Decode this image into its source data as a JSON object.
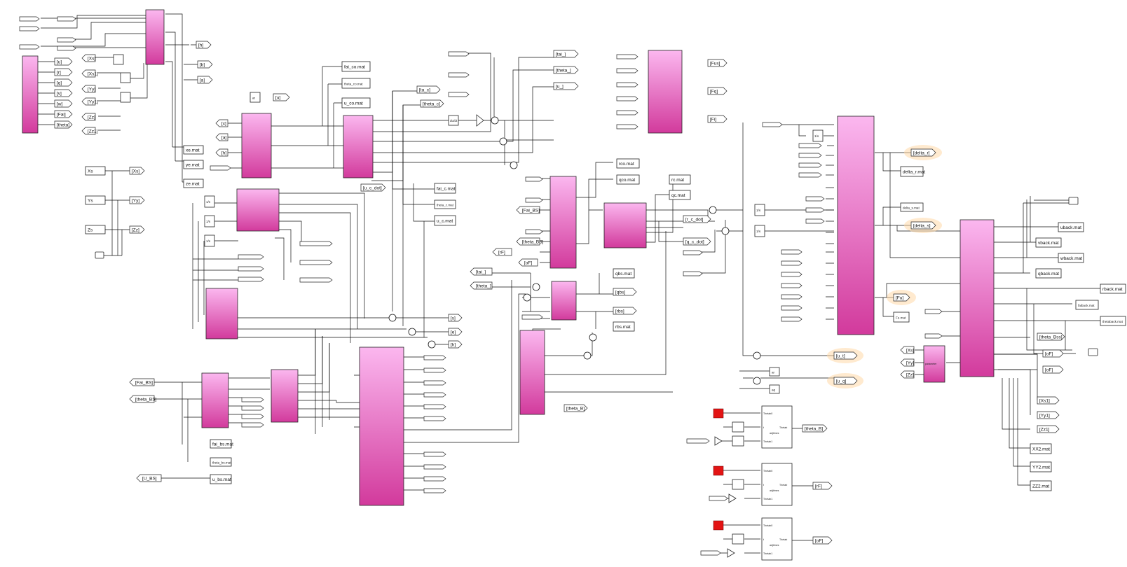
{
  "from_tags": {
    "left1": [
      "[u]",
      "[r]",
      "[q]",
      "[v]",
      "[w]",
      "[Fai]",
      "[theta]"
    ],
    "xyz": [
      "[Xs]",
      "[Xs1]",
      "[Yy]",
      "[Yy1]",
      "[Zz]",
      "[Zz1]"
    ],
    "uv": [
      "[x]",
      "[a]",
      "[h]"
    ],
    "mid": [
      "[tai_]",
      "[theta_]",
      "[Fai_BS]",
      "[theta_BS]",
      "[rF]",
      "[oF]"
    ],
    "left_bottom": [
      "[Fai_BS]",
      "[theta_BS]",
      "[U_BS]"
    ],
    "right": [
      "[Xs]",
      "[Yy]",
      "[Zz]"
    ]
  },
  "goto_tags": {
    "top_left": [
      "[h]",
      "[b]",
      "[a]"
    ],
    "center_top": [
      "[tai_]",
      "[theta_]",
      "[u_]"
    ],
    "center": [
      "[ta_c]",
      "[theta_c]",
      "[u_c_dot]"
    ],
    "xyz": [
      "[Xs]",
      "[Yy]",
      "[Zz]"
    ],
    "sum_outs": [
      "[s]",
      "[e]",
      "[h]"
    ],
    "fx": [
      "[Fus]",
      "[Fq]",
      "[Fi]"
    ],
    "mid": [
      "[r_c_dot]",
      "[q_c_dot]",
      "[qbs]",
      "[rbs]",
      "[theta_B]"
    ],
    "right_glow": [
      "[delta_r]",
      "[delta_s]",
      "[Fu]",
      "[u_t]",
      "[u_q]"
    ],
    "right2": [
      "[theta_Bss]",
      "[oF]",
      "[oF]"
    ],
    "right3": [
      "[Xs1]",
      "[Yy1]",
      "[Zz1]"
    ],
    "bottom": [
      "[theta_B]",
      "[rF]",
      "[oF]"
    ],
    "misc": [
      "[u]"
    ]
  },
  "consts": [
    "Xs",
    "Ys",
    "Zs"
  ],
  "mat_files": {
    "xyz": [
      "xe.mat",
      "ye.mat",
      "ze.mat"
    ],
    "center": [
      "fai_co.mat",
      "theta_co.mat",
      "u_co.mat"
    ],
    "cmat": [
      "fai_c.mat",
      "theta_c.mat",
      "u_c.mat"
    ],
    "rq": [
      "rco.mat",
      "qco.mat",
      "rc.mat",
      "qc.mat"
    ],
    "bs": [
      "qbs.mat",
      "rbs.mat"
    ],
    "delta": [
      "delta_r.mat",
      "delta_s.mat",
      "Fu.mat"
    ],
    "back": [
      "uback.mat",
      "vback.mat",
      "wback.mat",
      "qback.mat",
      "rback.mat",
      "faiback.mat",
      "thetaback.mat"
    ],
    "bs_left": [
      "fai_bs.mat",
      "theta_bs.mat",
      "u_bs.mat"
    ],
    "xx": [
      "XX2.mat",
      "YY2.mat",
      "ZZ2.mat"
    ]
  },
  "small_boxes": [
    "ar",
    "aq"
  ],
  "port_text": {
    "derivative": "du/dt",
    "gain": "K",
    "integrator": "1/s",
    "parameter": "parameter",
    "thetab": "Thetab",
    "adjtimes": "adjtimes",
    "thetab0": "Thetab0",
    "thetab1": "Thetab1",
    "t": "t"
  },
  "colors": {
    "block_light": "#f5a6e8",
    "block_dark": "#d6389e",
    "glow": "#ffc98a",
    "red": "#e31414"
  }
}
